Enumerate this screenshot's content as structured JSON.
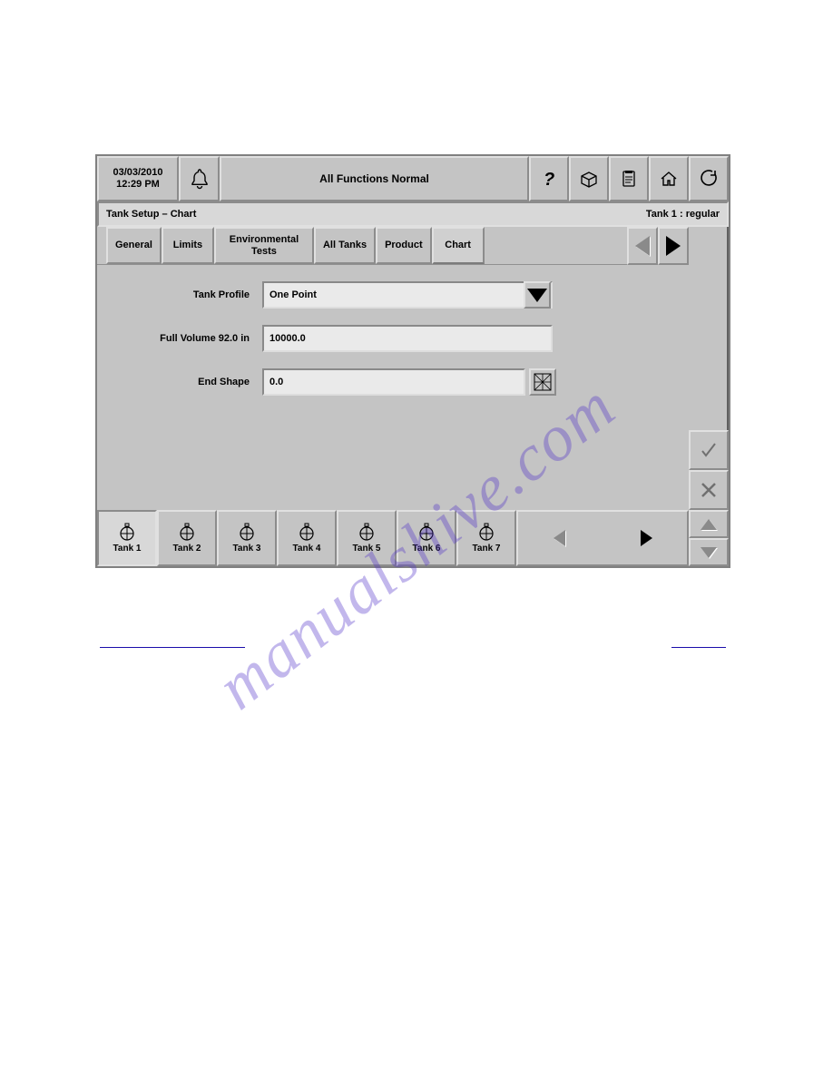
{
  "header": {
    "date": "03/03/2010",
    "time": "12:29 PM",
    "status": "All Functions Normal"
  },
  "subheader": {
    "title": "Tank Setup – Chart",
    "context": "Tank 1 : regular"
  },
  "tabs": [
    {
      "label": "General",
      "selected": false
    },
    {
      "label": "Limits",
      "selected": false
    },
    {
      "label": "Environmental\nTests",
      "selected": false
    },
    {
      "label": "All Tanks",
      "selected": false
    },
    {
      "label": "Product",
      "selected": false
    },
    {
      "label": "Chart",
      "selected": true
    }
  ],
  "form": {
    "tank_profile": {
      "label": "Tank Profile",
      "value": "One Point"
    },
    "full_volume": {
      "label": "Full Volume 92.0 in",
      "value": "10000.0"
    },
    "end_shape": {
      "label": "End Shape",
      "value": "0.0"
    }
  },
  "tanks": [
    {
      "label": "Tank 1",
      "active": true
    },
    {
      "label": "Tank 2",
      "active": false
    },
    {
      "label": "Tank 3",
      "active": false
    },
    {
      "label": "Tank 4",
      "active": false
    },
    {
      "label": "Tank 5",
      "active": false
    },
    {
      "label": "Tank 6",
      "active": false
    },
    {
      "label": "Tank 7",
      "active": false
    }
  ],
  "watermark": "manualshive.com"
}
